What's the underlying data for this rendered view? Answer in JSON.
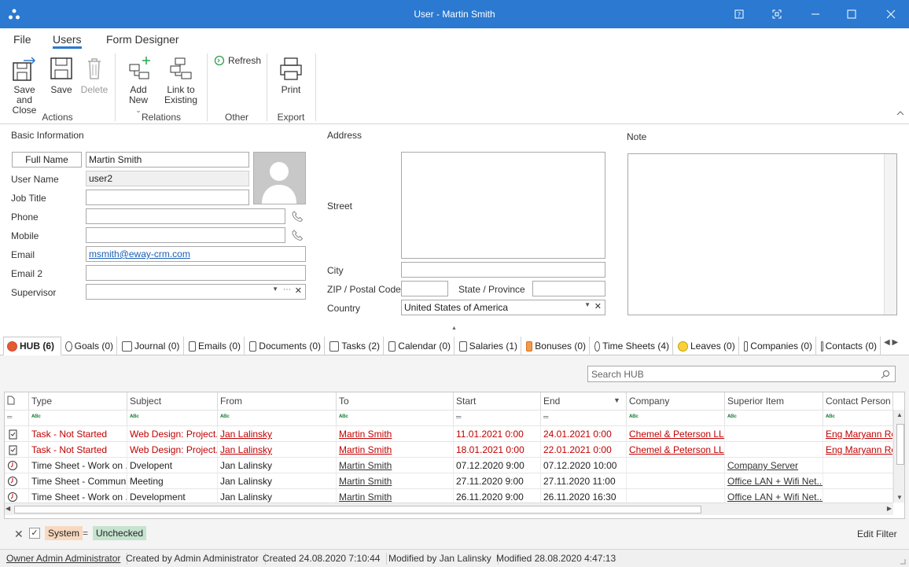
{
  "window": {
    "title": "User - Martin Smith"
  },
  "menu": {
    "file": "File",
    "users": "Users",
    "form_designer": "Form Designer"
  },
  "ribbon": {
    "save_close": "Save and Close",
    "save": "Save",
    "delete": "Delete",
    "add_new": "Add New",
    "link_existing": "Link to Existing",
    "refresh": "Refresh",
    "print": "Print",
    "groups": {
      "actions": "Actions",
      "relations": "Relations",
      "other": "Other",
      "export": "Export"
    }
  },
  "basic": {
    "section": "Basic Information",
    "full_name_btn": "Full Name",
    "full_name": "Martin Smith",
    "user_name_label": "User Name",
    "user_name": "user2",
    "job_title_label": "Job Title",
    "phone_label": "Phone",
    "mobile_label": "Mobile",
    "email_label": "Email",
    "email": "msmith@eway-crm.com",
    "email2_label": "Email 2",
    "supervisor_label": "Supervisor"
  },
  "address": {
    "section": "Address",
    "street_label": "Street",
    "city_label": "City",
    "zip_label": "ZIP / Postal Code",
    "state_label": "State / Province",
    "country_label": "Country",
    "country": "United States of America"
  },
  "note": {
    "section": "Note"
  },
  "tabs": [
    {
      "label": "HUB (6)",
      "icon": "hub-icon"
    },
    {
      "label": "Goals (0)",
      "icon": "target-icon"
    },
    {
      "label": "Journal (0)",
      "icon": "journal-icon"
    },
    {
      "label": "Emails (0)",
      "icon": "envelope-icon"
    },
    {
      "label": "Documents (0)",
      "icon": "document-icon"
    },
    {
      "label": "Tasks (2)",
      "icon": "clipboard-icon"
    },
    {
      "label": "Calendar (0)",
      "icon": "calendar-icon"
    },
    {
      "label": "Salaries (1)",
      "icon": "salary-icon"
    },
    {
      "label": "Bonuses (0)",
      "icon": "bonus-icon"
    },
    {
      "label": "Time Sheets (4)",
      "icon": "clock-icon"
    },
    {
      "label": "Leaves (0)",
      "icon": "smiley-icon"
    },
    {
      "label": "Companies (0)",
      "icon": "building-icon"
    },
    {
      "label": "Contacts (0)",
      "icon": "contact-card-icon"
    }
  ],
  "hub": {
    "search_placeholder": "Search HUB",
    "columns": [
      "Type",
      "Subject",
      "From",
      "To",
      "Start",
      "End",
      "Company",
      "Superior Item",
      "Contact Person"
    ],
    "rows": [
      {
        "kind": "task",
        "type": "Task - Not Started",
        "subject": "Web Design: Project...",
        "from": "Jan Lalinsky",
        "to": "Martin Smith",
        "start": "11.01.2021 0:00",
        "end": "24.01.2021 0:00",
        "company": "Chemel & Peterson LLC",
        "superior": "",
        "contact": "Eng Maryann Roy"
      },
      {
        "kind": "task",
        "type": "Task - Not Started",
        "subject": "Web Design: Project...",
        "from": "Jan Lalinsky",
        "to": "Martin Smith",
        "start": "18.01.2021 0:00",
        "end": "22.01.2021 0:00",
        "company": "Chemel & Peterson LLC",
        "superior": "",
        "contact": "Eng Maryann Roy"
      },
      {
        "kind": "time",
        "type": "Time Sheet - Work on ...",
        "subject": "Dvelopent",
        "from": "Jan Lalinsky",
        "to": "Martin Smith",
        "start": "07.12.2020 9:00",
        "end": "07.12.2020 10:00",
        "company": "",
        "superior": "Company Server",
        "contact": ""
      },
      {
        "kind": "time",
        "type": "Time Sheet - Communi...",
        "subject": "Meeting",
        "from": "Jan Lalinsky",
        "to": "Martin Smith",
        "start": "27.11.2020 9:00",
        "end": "27.11.2020 11:00",
        "company": "",
        "superior": "Office LAN + Wifi Net...",
        "contact": ""
      },
      {
        "kind": "time",
        "type": "Time Sheet - Work on ...",
        "subject": "Development",
        "from": "Jan Lalinsky",
        "to": "Martin Smith",
        "start": "26.11.2020 9:00",
        "end": "26.11.2020 16:30",
        "company": "",
        "superior": "Office LAN + Wifi Net...",
        "contact": ""
      }
    ]
  },
  "filter": {
    "field": "System",
    "op": "=",
    "value": "Unchecked",
    "edit": "Edit Filter"
  },
  "status": {
    "owner": "Owner Admin Administrator",
    "created_by": "Created by Admin Administrator",
    "created": "Created 24.08.2020 7:10:44",
    "modified_by": "Modified by Jan Lalinsky",
    "modified": "Modified 28.08.2020 4:47:13"
  }
}
